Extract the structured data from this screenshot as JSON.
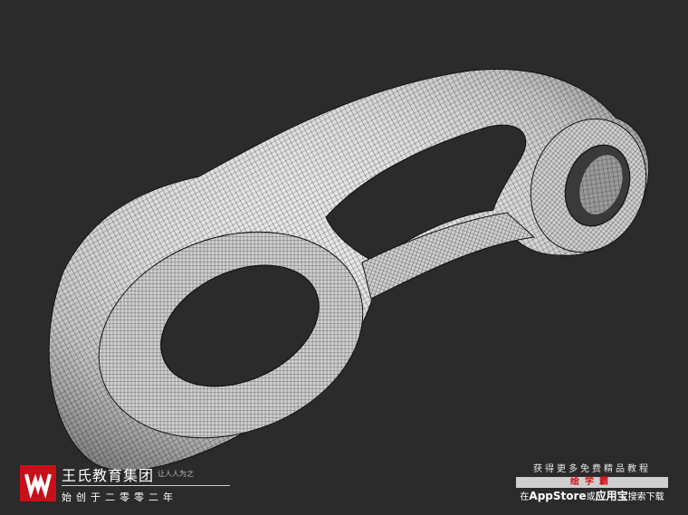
{
  "brand": {
    "name": "王氏教育集团",
    "tagline": "让人人为之",
    "founded": "始创于二零零二年",
    "accent": "#c8101a",
    "logo_icon": "w-logo-icon"
  },
  "promo": {
    "line1": "获得更多免费精品教程",
    "app_name": "绘学霸",
    "line3_prefix": "在",
    "store1": "AppStore",
    "line3_mid": "或",
    "store2": "应用宝",
    "line3_suffix": "搜索下载",
    "app_color": "#d0121b"
  },
  "viewport": {
    "background": "#2b2b2b",
    "subject": "wireframe-mesh-model"
  }
}
